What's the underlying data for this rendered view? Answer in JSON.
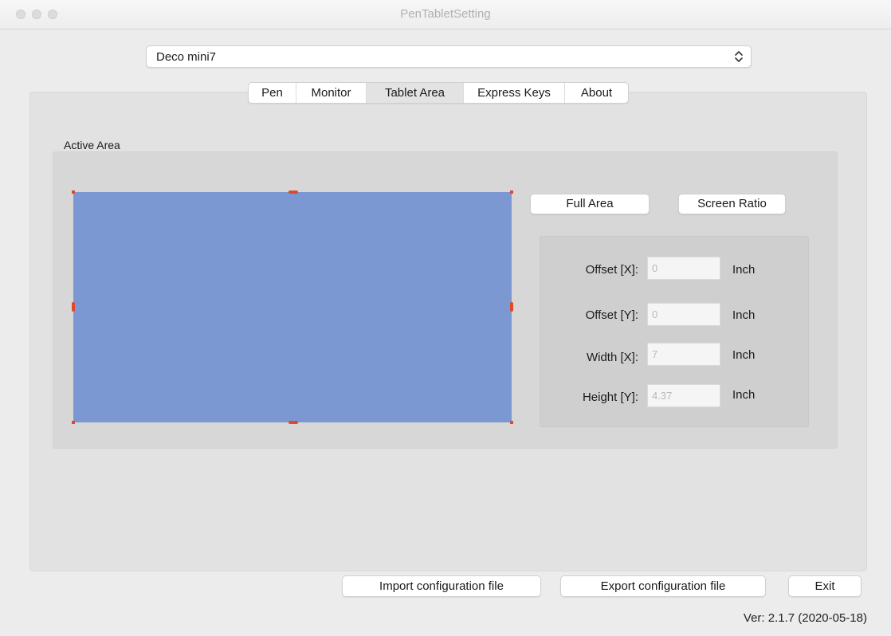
{
  "window": {
    "title": "PenTabletSetting"
  },
  "device": {
    "selected": "Deco mini7"
  },
  "tabs": [
    {
      "label": "Pen"
    },
    {
      "label": "Monitor"
    },
    {
      "label": "Tablet Area",
      "active": true
    },
    {
      "label": "Express Keys"
    },
    {
      "label": "About"
    }
  ],
  "active_area": {
    "label": "Active Area",
    "full_area_button": "Full Area",
    "screen_ratio_button": "Screen Ratio",
    "fields": [
      {
        "label": "Offset [X]:",
        "value": "0",
        "unit": "Inch"
      },
      {
        "label": "Offset [Y]:",
        "value": "0",
        "unit": "Inch"
      },
      {
        "label": "Width [X]:",
        "value": "7",
        "unit": "Inch"
      },
      {
        "label": "Height [Y]:",
        "value": "4.37",
        "unit": "Inch"
      }
    ]
  },
  "footer": {
    "import_label": "Import configuration file",
    "export_label": "Export configuration file",
    "exit_label": "Exit",
    "version": "Ver: 2.1.7 (2020-05-18)"
  },
  "colors": {
    "active_area_fill": "#7b98d2",
    "handle": "#e04a2a"
  },
  "icons": {
    "window_controls": [
      "close-icon",
      "minimize-icon",
      "zoom-icon"
    ],
    "select_arrow": "updown-chevron-icon"
  }
}
